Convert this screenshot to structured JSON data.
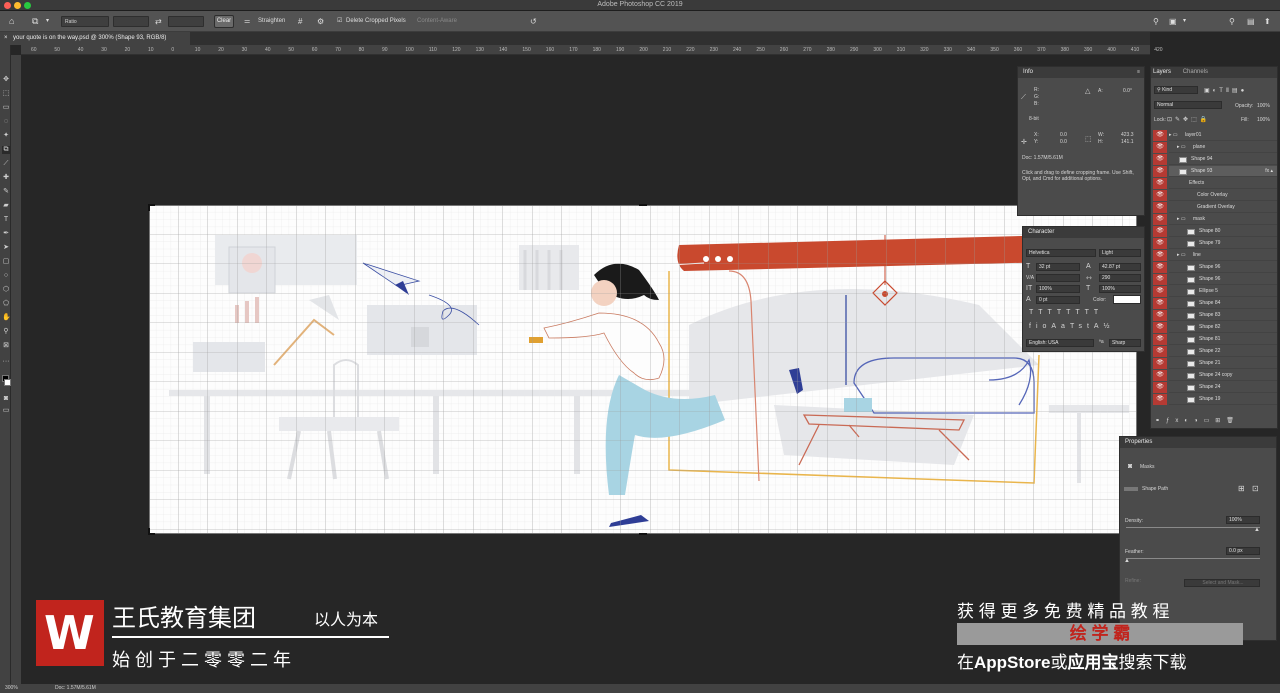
{
  "window": {
    "title": "Adobe Photoshop CC 2019"
  },
  "options": {
    "ratio": "Ratio",
    "clear": "Clear",
    "straighten": "Straighten",
    "delete_cropped": "Delete Cropped Pixels",
    "content_aware": "Content-Aware"
  },
  "document": {
    "tab": "your quote is on the way.psd @ 300% (Shape 93, RGB/8)"
  },
  "ruler": {
    "marks": [
      "60",
      "50",
      "40",
      "30",
      "20",
      "10",
      "0",
      "10",
      "20",
      "30",
      "40",
      "50",
      "60",
      "70",
      "80",
      "90",
      "100",
      "110",
      "120",
      "130",
      "140",
      "150",
      "160",
      "170",
      "180",
      "190",
      "200",
      "210",
      "220",
      "230",
      "240",
      "250",
      "260",
      "270",
      "280",
      "290",
      "300",
      "310",
      "320",
      "330",
      "340",
      "350",
      "360",
      "370",
      "380",
      "390",
      "400",
      "410",
      "420"
    ]
  },
  "info": {
    "title": "Info",
    "r": "R:",
    "g": "G:",
    "b": "B:",
    "bit": "8-bit",
    "a_label": "A:",
    "a_value": "0.0°",
    "x": "X:",
    "y": "Y:",
    "x_val": "0.0",
    "y_val": "0.0",
    "w": "W:",
    "h": "H:",
    "w_val": "423.3",
    "h_val": "141.1",
    "doc": "Doc: 1.57M/5.61M",
    "hint": "Click and drag to define cropping frame. Use Shift, Opt, and Cmd for additional options."
  },
  "character": {
    "title": "Character",
    "font": "Helvetica",
    "style": "Light",
    "size": "32 pt",
    "leading": "42.87 pt",
    "kerning": "V/A",
    "tracking": "290",
    "vscale": "100%",
    "hscale": "100%",
    "baseline": "0 pt",
    "color": "Color:",
    "lang": "English: USA",
    "aa": "Sharp"
  },
  "layers_panel": {
    "tab_layers": "Layers",
    "tab_channels": "Channels",
    "kind": "Kind",
    "blend": "Normal",
    "opacity_label": "Opacity:",
    "opacity": "100%",
    "lock": "Lock:",
    "fill_label": "Fill:",
    "fill": "100%",
    "layers": [
      {
        "name": "layer01",
        "indent": 0,
        "group": true
      },
      {
        "name": "plane",
        "indent": 1,
        "group": true
      },
      {
        "name": "Shape 94",
        "indent": 1,
        "group": false
      },
      {
        "name": "Shape 93",
        "indent": 1,
        "group": false,
        "selected": true
      },
      {
        "name": "Effects",
        "indent": 2,
        "group": false
      },
      {
        "name": "Color Overlay",
        "indent": 3,
        "group": false
      },
      {
        "name": "Gradient Overlay",
        "indent": 3,
        "group": false
      },
      {
        "name": "mask",
        "indent": 1,
        "group": true
      },
      {
        "name": "Shape 80",
        "indent": 2,
        "group": false
      },
      {
        "name": "Shape 79",
        "indent": 2,
        "group": false
      },
      {
        "name": "line",
        "indent": 1,
        "group": true
      },
      {
        "name": "Shape 96",
        "indent": 2,
        "group": false
      },
      {
        "name": "Shape 96",
        "indent": 2,
        "group": false
      },
      {
        "name": "Ellipse 5",
        "indent": 2,
        "group": false
      },
      {
        "name": "Shape 84",
        "indent": 2,
        "group": false
      },
      {
        "name": "Shape 83",
        "indent": 2,
        "group": false
      },
      {
        "name": "Shape 82",
        "indent": 2,
        "group": false
      },
      {
        "name": "Shape 81",
        "indent": 2,
        "group": false
      },
      {
        "name": "Shape 22",
        "indent": 2,
        "group": false
      },
      {
        "name": "Shape 21",
        "indent": 2,
        "group": false
      },
      {
        "name": "Shape 24 copy",
        "indent": 2,
        "group": false
      },
      {
        "name": "Shape 24",
        "indent": 2,
        "group": false
      },
      {
        "name": "Shape 19",
        "indent": 2,
        "group": false
      }
    ]
  },
  "properties": {
    "title": "Properties",
    "masks": "Masks",
    "shape_path": "Shape Path",
    "density": "Density:",
    "density_val": "100%",
    "feather": "Feather:",
    "feather_val": "0.0 px",
    "refine": "Refine:",
    "select_mask": "Select and Mask..."
  },
  "status": {
    "zoom": "300%",
    "doc": "Doc: 1.57M/5.61M"
  },
  "watermark": {
    "org": "王氏教育集团",
    "motto": "以人为本",
    "since": "始 创 于 二 零 零 二 年",
    "get_more": "获 得 更 多 免 费 精 品 教 程",
    "app": "绘 学 霸",
    "store_prefix": "在",
    "store_name": "AppStore",
    "store_or": "或",
    "store_alt": "应用宝",
    "store_suffix": "搜索下载"
  },
  "colors": {
    "accent_red": "#c9492e",
    "eye_bg": "#b53a33",
    "panel": "#4b4b4b"
  }
}
